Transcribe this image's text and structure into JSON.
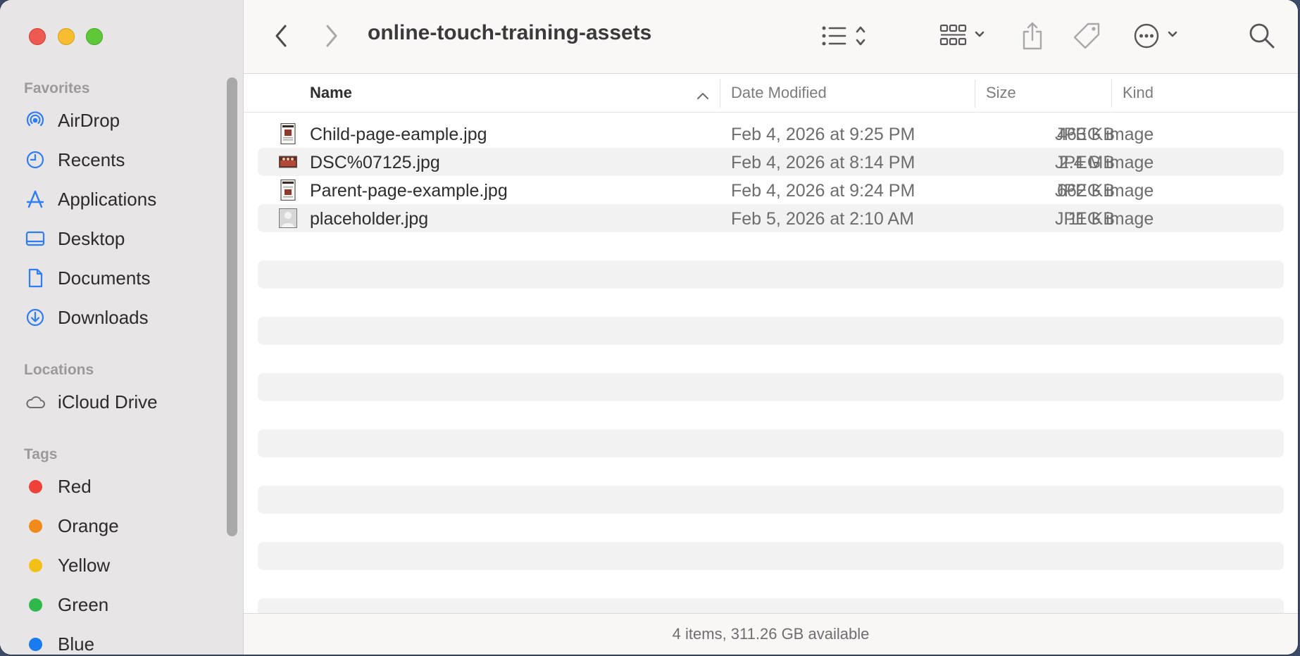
{
  "window": {
    "title": "online-touch-training-assets"
  },
  "sidebar": {
    "favorites_title": "Favorites",
    "favorites": [
      {
        "label": "AirDrop",
        "icon": "airdrop-icon"
      },
      {
        "label": "Recents",
        "icon": "clock-icon"
      },
      {
        "label": "Applications",
        "icon": "applications-icon"
      },
      {
        "label": "Desktop",
        "icon": "desktop-icon"
      },
      {
        "label": "Documents",
        "icon": "document-icon"
      },
      {
        "label": "Downloads",
        "icon": "download-icon"
      }
    ],
    "locations_title": "Locations",
    "locations": [
      {
        "label": "iCloud Drive",
        "icon": "cloud-icon"
      }
    ],
    "tags_title": "Tags",
    "tags": [
      {
        "label": "Red",
        "color": "#ee4137"
      },
      {
        "label": "Orange",
        "color": "#f18a1b"
      },
      {
        "label": "Yellow",
        "color": "#f3c017"
      },
      {
        "label": "Green",
        "color": "#2fb94b"
      },
      {
        "label": "Blue",
        "color": "#1a7af0"
      }
    ],
    "accent_color": "#2e7cf6"
  },
  "columns": {
    "name": "Name",
    "date": "Date Modified",
    "size": "Size",
    "kind": "Kind"
  },
  "files": [
    {
      "name": "Child-page-eample.jpg",
      "date": "Feb 4, 2026 at 9:25 PM",
      "size": "463 KB",
      "kind": "JPEG image",
      "thumb": "portrait-thumbnail-icon"
    },
    {
      "name": "DSC%07125.jpg",
      "date": "Feb 4, 2026 at 8:14 PM",
      "size": "2.4 MB",
      "kind": "JPEG image",
      "thumb": "photo-thumbnail-icon"
    },
    {
      "name": "Parent-page-example.jpg",
      "date": "Feb 4, 2026 at 9:24 PM",
      "size": "662 KB",
      "kind": "JPEG image",
      "thumb": "portrait-thumbnail-icon"
    },
    {
      "name": "placeholder.jpg",
      "date": "Feb 5, 2026 at 2:10 AM",
      "size": "11 KB",
      "kind": "JPEG image",
      "thumb": "person-placeholder-icon"
    }
  ],
  "status": {
    "text": "4 items, 311.26 GB available"
  }
}
